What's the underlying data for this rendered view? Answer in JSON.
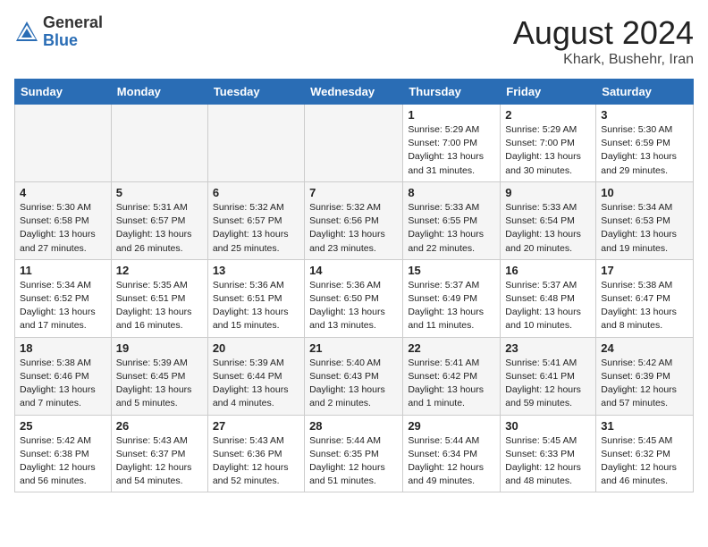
{
  "header": {
    "logo_general": "General",
    "logo_blue": "Blue",
    "month_year": "August 2024",
    "location": "Khark, Bushehr, Iran"
  },
  "weekdays": [
    "Sunday",
    "Monday",
    "Tuesday",
    "Wednesday",
    "Thursday",
    "Friday",
    "Saturday"
  ],
  "weeks": [
    [
      {
        "day": "",
        "info": ""
      },
      {
        "day": "",
        "info": ""
      },
      {
        "day": "",
        "info": ""
      },
      {
        "day": "",
        "info": ""
      },
      {
        "day": "1",
        "info": "Sunrise: 5:29 AM\nSunset: 7:00 PM\nDaylight: 13 hours and 31 minutes."
      },
      {
        "day": "2",
        "info": "Sunrise: 5:29 AM\nSunset: 7:00 PM\nDaylight: 13 hours and 30 minutes."
      },
      {
        "day": "3",
        "info": "Sunrise: 5:30 AM\nSunset: 6:59 PM\nDaylight: 13 hours and 29 minutes."
      }
    ],
    [
      {
        "day": "4",
        "info": "Sunrise: 5:30 AM\nSunset: 6:58 PM\nDaylight: 13 hours and 27 minutes."
      },
      {
        "day": "5",
        "info": "Sunrise: 5:31 AM\nSunset: 6:57 PM\nDaylight: 13 hours and 26 minutes."
      },
      {
        "day": "6",
        "info": "Sunrise: 5:32 AM\nSunset: 6:57 PM\nDaylight: 13 hours and 25 minutes."
      },
      {
        "day": "7",
        "info": "Sunrise: 5:32 AM\nSunset: 6:56 PM\nDaylight: 13 hours and 23 minutes."
      },
      {
        "day": "8",
        "info": "Sunrise: 5:33 AM\nSunset: 6:55 PM\nDaylight: 13 hours and 22 minutes."
      },
      {
        "day": "9",
        "info": "Sunrise: 5:33 AM\nSunset: 6:54 PM\nDaylight: 13 hours and 20 minutes."
      },
      {
        "day": "10",
        "info": "Sunrise: 5:34 AM\nSunset: 6:53 PM\nDaylight: 13 hours and 19 minutes."
      }
    ],
    [
      {
        "day": "11",
        "info": "Sunrise: 5:34 AM\nSunset: 6:52 PM\nDaylight: 13 hours and 17 minutes."
      },
      {
        "day": "12",
        "info": "Sunrise: 5:35 AM\nSunset: 6:51 PM\nDaylight: 13 hours and 16 minutes."
      },
      {
        "day": "13",
        "info": "Sunrise: 5:36 AM\nSunset: 6:51 PM\nDaylight: 13 hours and 15 minutes."
      },
      {
        "day": "14",
        "info": "Sunrise: 5:36 AM\nSunset: 6:50 PM\nDaylight: 13 hours and 13 minutes."
      },
      {
        "day": "15",
        "info": "Sunrise: 5:37 AM\nSunset: 6:49 PM\nDaylight: 13 hours and 11 minutes."
      },
      {
        "day": "16",
        "info": "Sunrise: 5:37 AM\nSunset: 6:48 PM\nDaylight: 13 hours and 10 minutes."
      },
      {
        "day": "17",
        "info": "Sunrise: 5:38 AM\nSunset: 6:47 PM\nDaylight: 13 hours and 8 minutes."
      }
    ],
    [
      {
        "day": "18",
        "info": "Sunrise: 5:38 AM\nSunset: 6:46 PM\nDaylight: 13 hours and 7 minutes."
      },
      {
        "day": "19",
        "info": "Sunrise: 5:39 AM\nSunset: 6:45 PM\nDaylight: 13 hours and 5 minutes."
      },
      {
        "day": "20",
        "info": "Sunrise: 5:39 AM\nSunset: 6:44 PM\nDaylight: 13 hours and 4 minutes."
      },
      {
        "day": "21",
        "info": "Sunrise: 5:40 AM\nSunset: 6:43 PM\nDaylight: 13 hours and 2 minutes."
      },
      {
        "day": "22",
        "info": "Sunrise: 5:41 AM\nSunset: 6:42 PM\nDaylight: 13 hours and 1 minute."
      },
      {
        "day": "23",
        "info": "Sunrise: 5:41 AM\nSunset: 6:41 PM\nDaylight: 12 hours and 59 minutes."
      },
      {
        "day": "24",
        "info": "Sunrise: 5:42 AM\nSunset: 6:39 PM\nDaylight: 12 hours and 57 minutes."
      }
    ],
    [
      {
        "day": "25",
        "info": "Sunrise: 5:42 AM\nSunset: 6:38 PM\nDaylight: 12 hours and 56 minutes."
      },
      {
        "day": "26",
        "info": "Sunrise: 5:43 AM\nSunset: 6:37 PM\nDaylight: 12 hours and 54 minutes."
      },
      {
        "day": "27",
        "info": "Sunrise: 5:43 AM\nSunset: 6:36 PM\nDaylight: 12 hours and 52 minutes."
      },
      {
        "day": "28",
        "info": "Sunrise: 5:44 AM\nSunset: 6:35 PM\nDaylight: 12 hours and 51 minutes."
      },
      {
        "day": "29",
        "info": "Sunrise: 5:44 AM\nSunset: 6:34 PM\nDaylight: 12 hours and 49 minutes."
      },
      {
        "day": "30",
        "info": "Sunrise: 5:45 AM\nSunset: 6:33 PM\nDaylight: 12 hours and 48 minutes."
      },
      {
        "day": "31",
        "info": "Sunrise: 5:45 AM\nSunset: 6:32 PM\nDaylight: 12 hours and 46 minutes."
      }
    ]
  ]
}
